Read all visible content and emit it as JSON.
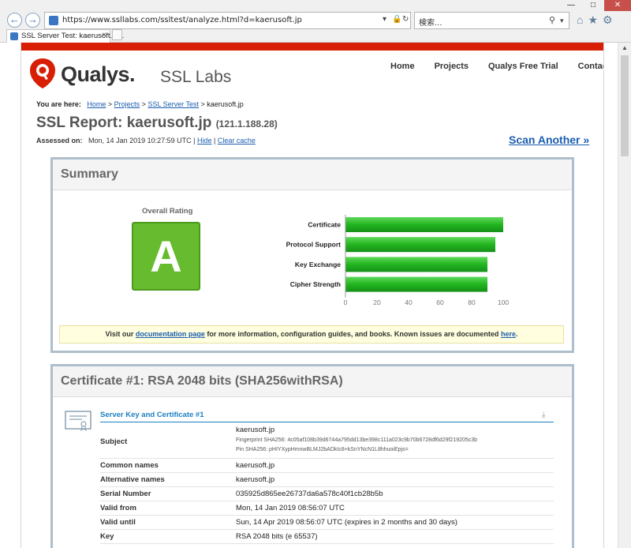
{
  "browser": {
    "url": "https://www.ssllabs.com/ssltest/analyze.html?d=kaerusoft.jp",
    "search_placeholder": "検索...",
    "tab_title": "SSL Server Test: kaerusoft.jp...",
    "tab_close": "×"
  },
  "header": {
    "logo_word": "Qualys.",
    "logo_sub": "SSL Labs",
    "nav": [
      "Home",
      "Projects",
      "Qualys Free Trial",
      "Contact"
    ]
  },
  "breadcrumb": {
    "prefix": "You are here:",
    "items": [
      "Home",
      "Projects",
      "SSL Server Test"
    ],
    "current": "kaerusoft.jp"
  },
  "report": {
    "title": "SSL Report: kaerusoft.jp",
    "ip": "(121.1.188.28)",
    "assessed_label": "Assessed on:",
    "assessed_value": "Mon, 14 Jan 2019 10:27:59 UTC",
    "hide": "Hide",
    "clear_cache": "Clear cache",
    "scan_another": "Scan Another »"
  },
  "summary": {
    "heading": "Summary",
    "overall_label": "Overall Rating",
    "grade": "A",
    "notice_pre": "Visit our",
    "notice_link": "documentation page",
    "notice_mid": "for more information, configuration guides, and books. Known issues are documented",
    "notice_link2": "here",
    "notice_end": "."
  },
  "chart_data": {
    "type": "bar",
    "orientation": "horizontal",
    "categories": [
      "Certificate",
      "Protocol Support",
      "Key Exchange",
      "Cipher Strength"
    ],
    "values": [
      100,
      95,
      90,
      90
    ],
    "xlim": [
      0,
      100
    ],
    "xticks": [
      0,
      20,
      40,
      60,
      80,
      100
    ],
    "title": "",
    "xlabel": "",
    "ylabel": "",
    "bar_color": "#22b51f"
  },
  "certificate": {
    "heading": "Certificate #1: RSA 2048 bits (SHA256withRSA)",
    "section_title": "Server Key and Certificate #1",
    "subject_label": "Subject",
    "subject_value": "kaerusoft.jp",
    "fingerprint": "Fingerprint SHA256: 4c05af108b39d6744a795dd13be398c111a023c9b70b6728df6d29f219205c3b",
    "pin": "Pin SHA256: pHIYXypHmnwBLMJ2bADkIc8+kSnYNcN1L8hhuoiEpjs=",
    "rows": [
      {
        "label": "Common names",
        "value": "kaerusoft.jp"
      },
      {
        "label": "Alternative names",
        "value": "kaerusoft.jp"
      },
      {
        "label": "Serial Number",
        "value": "035925d865ee26737da6a578c40f1cb28b5b"
      },
      {
        "label": "Valid from",
        "value": "Mon, 14 Jan 2019 08:56:07 UTC"
      },
      {
        "label": "Valid until",
        "value": "Sun, 14 Apr 2019 08:56:07 UTC (expires in 2 months and 30 days)"
      },
      {
        "label": "Key",
        "value": "RSA 2048 bits (e 65537)"
      }
    ]
  }
}
